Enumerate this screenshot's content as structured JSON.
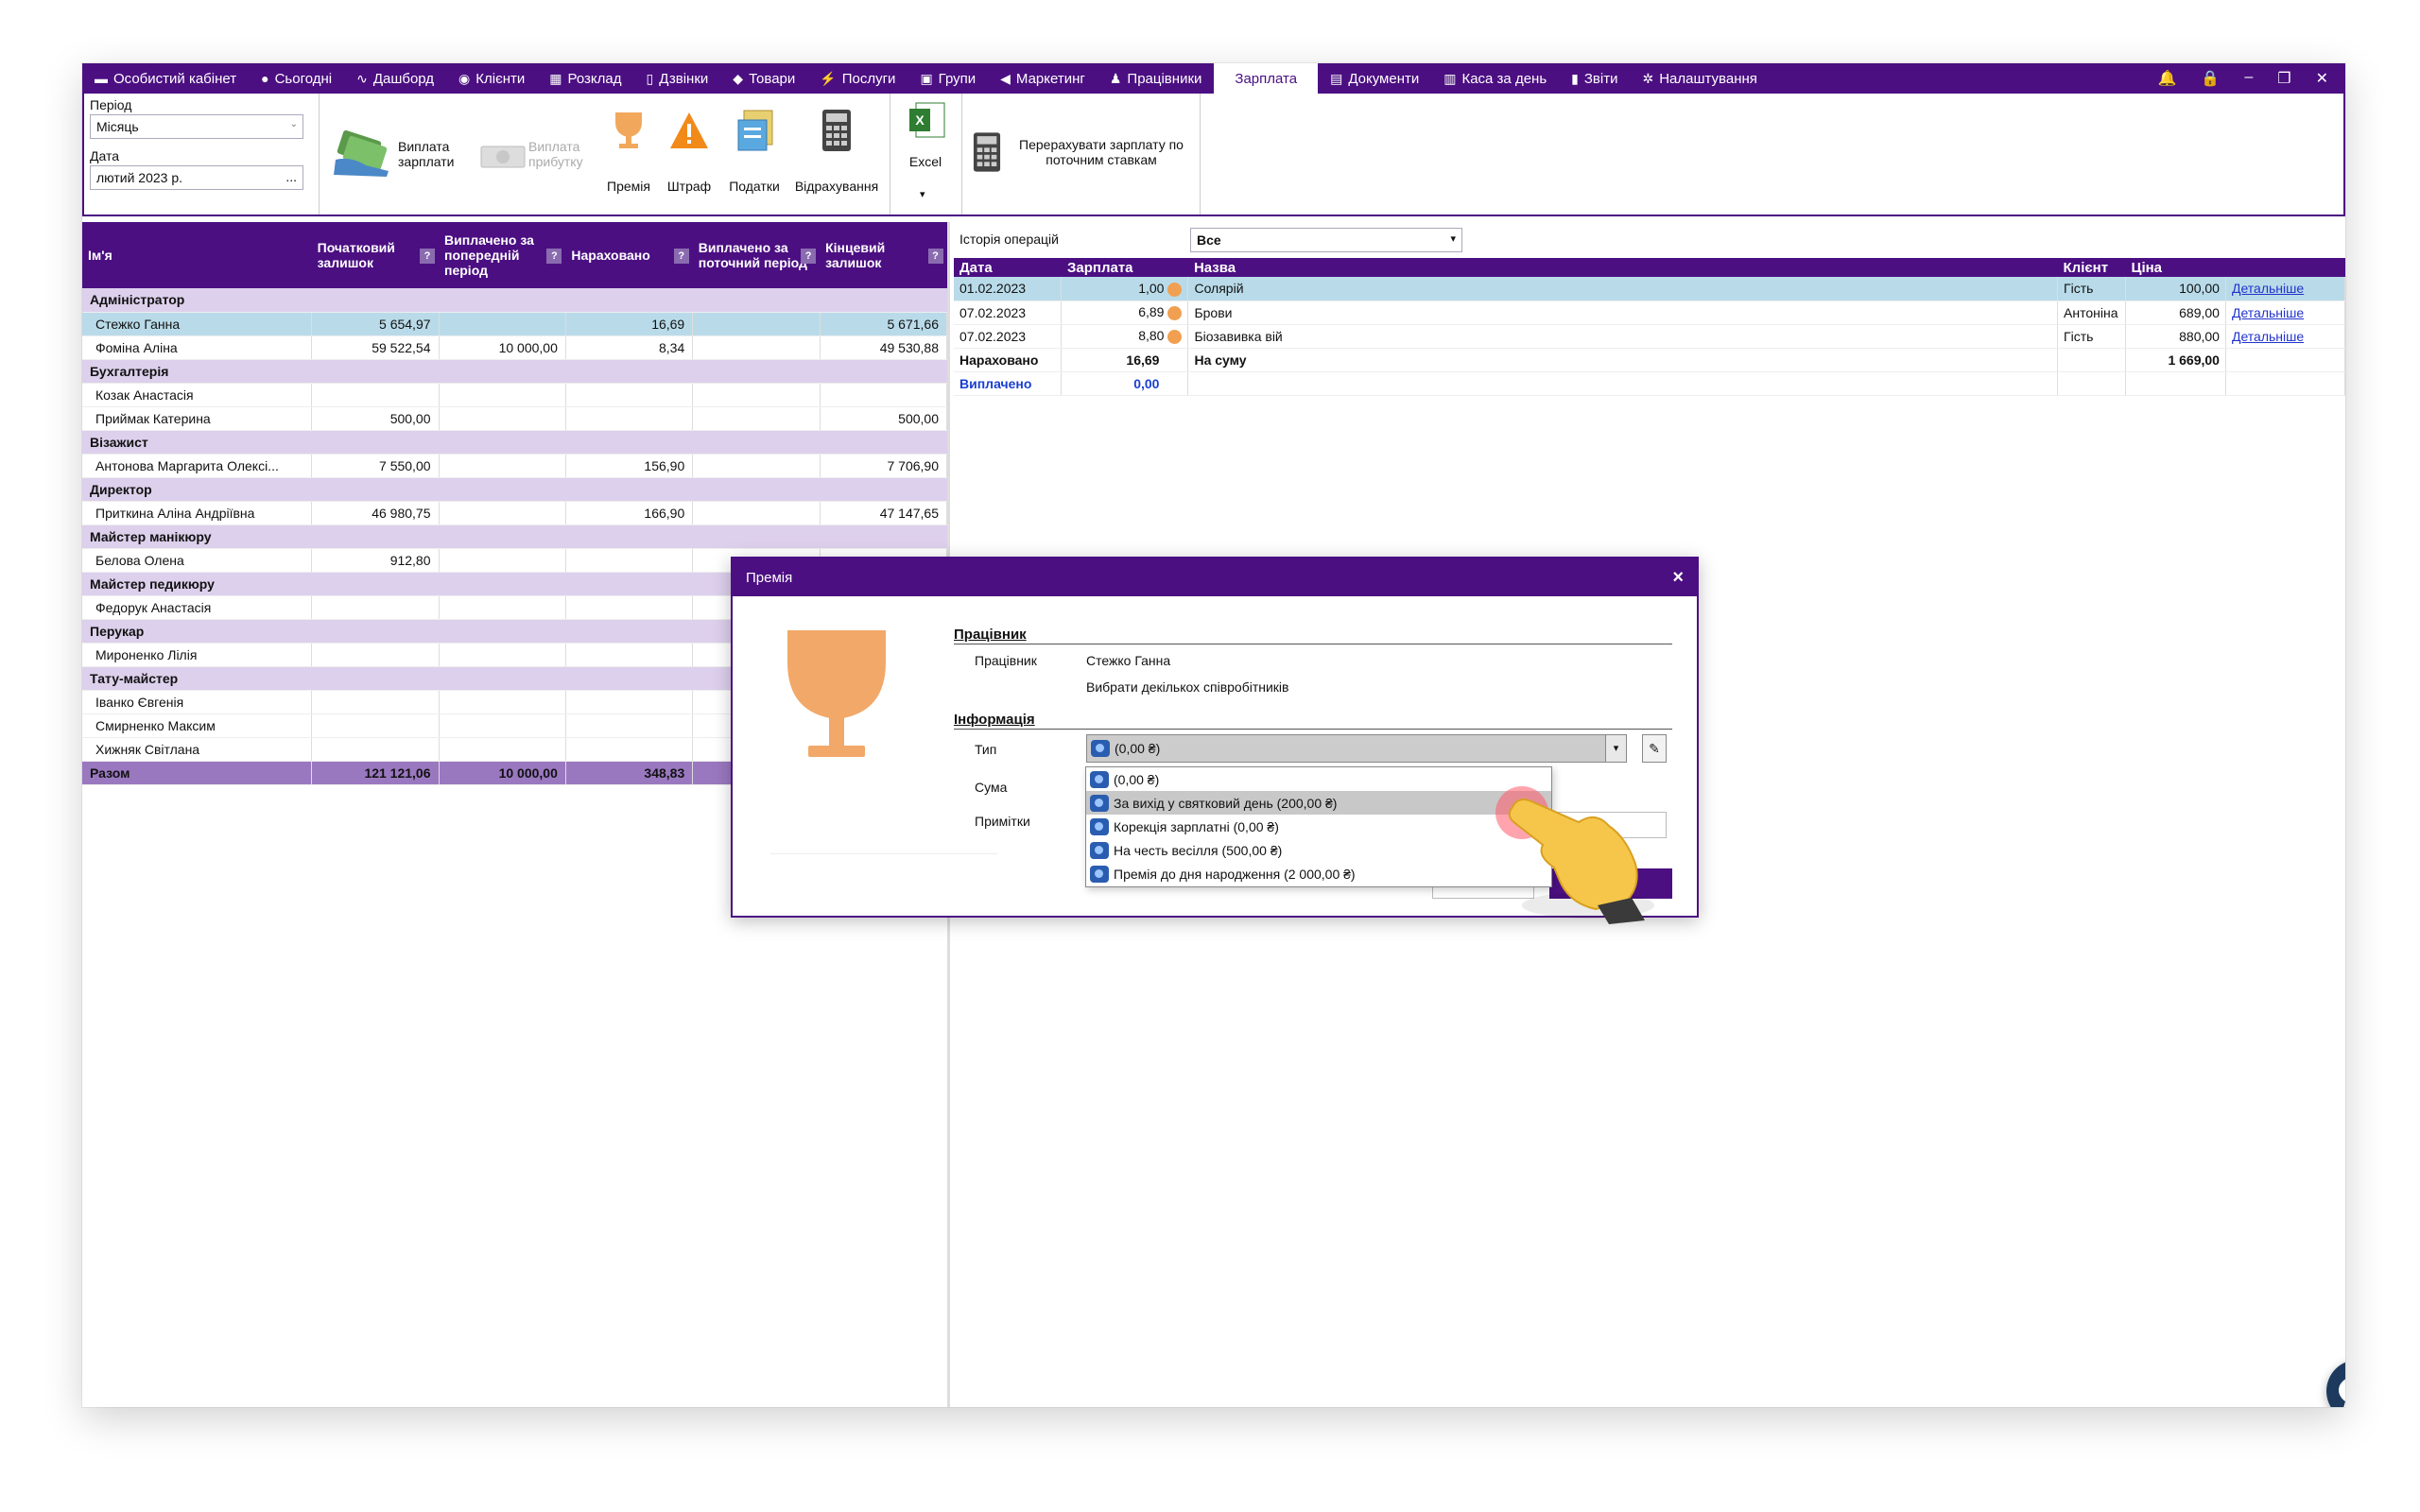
{
  "nav": {
    "items": [
      {
        "label": "Особистий кабінет",
        "icon": "briefcase-icon"
      },
      {
        "label": "Сьогодні",
        "icon": "circle-icon"
      },
      {
        "label": "Дашборд",
        "icon": "pulse-icon"
      },
      {
        "label": "Клієнти",
        "icon": "user-circle-icon"
      },
      {
        "label": "Розклад",
        "icon": "calendar-icon"
      },
      {
        "label": "Дзвінки",
        "icon": "phone-icon"
      },
      {
        "label": "Товари",
        "icon": "box-icon"
      },
      {
        "label": "Послуги",
        "icon": "bolt-icon"
      },
      {
        "label": "Групи",
        "icon": "group-icon"
      },
      {
        "label": "Маркетинг",
        "icon": "megaphone-icon"
      },
      {
        "label": "Працівники",
        "icon": "person-icon"
      },
      {
        "label": "Зарплата",
        "icon": ""
      },
      {
        "label": "Документи",
        "icon": "document-icon"
      },
      {
        "label": "Каса за день",
        "icon": "calculator-icon"
      },
      {
        "label": "Звіти",
        "icon": "bar-chart-icon"
      },
      {
        "label": "Налаштування",
        "icon": "gear-icon"
      }
    ],
    "active": "Зарплата"
  },
  "ribbon": {
    "period_label": "Період",
    "period_value": "Місяць",
    "date_label": "Дата",
    "date_value": "лютий  2023 р.",
    "date_btn": "...",
    "pay_salary": "Виплата зарплати",
    "pay_profit": "Виплата прибутку",
    "bonus": "Премія",
    "fine": "Штраф",
    "taxes": "Податки",
    "deductions": "Відрахування",
    "excel": "Excel",
    "recalc": "Перерахувати зарплату по поточним ставкам"
  },
  "left": {
    "headers": [
      "Ім'я",
      "Початковий залишок",
      "Виплачено за попередній період",
      "Нараховано",
      "Виплачено за поточний період",
      "Кінцевий залишок"
    ],
    "rows": [
      {
        "type": "grp",
        "name": "Адміністратор"
      },
      {
        "type": "sel",
        "name": "Стежко Ганна",
        "c1": "5 654,97",
        "c2": "",
        "c3": "16,69",
        "c4": "",
        "c5": "5 671,66"
      },
      {
        "type": "row",
        "name": "Фоміна Аліна",
        "c1": "59 522,54",
        "c2": "10 000,00",
        "c3": "8,34",
        "c4": "",
        "c5": "49 530,88"
      },
      {
        "type": "grp",
        "name": "Бухгалтерія"
      },
      {
        "type": "row",
        "name": "Козак Анастасія",
        "c1": "",
        "c2": "",
        "c3": "",
        "c4": "",
        "c5": ""
      },
      {
        "type": "row",
        "name": "Приймак Катерина",
        "c1": "500,00",
        "c2": "",
        "c3": "",
        "c4": "",
        "c5": "500,00"
      },
      {
        "type": "grp",
        "name": "Візажист"
      },
      {
        "type": "row",
        "name": "Антонова Маргарита Олексі...",
        "c1": "7 550,00",
        "c2": "",
        "c3": "156,90",
        "c4": "",
        "c5": "7 706,90"
      },
      {
        "type": "grp",
        "name": "Директор"
      },
      {
        "type": "row",
        "name": "Приткина Аліна Андріївна",
        "c1": "46 980,75",
        "c2": "",
        "c3": "166,90",
        "c4": "",
        "c5": "47 147,65"
      },
      {
        "type": "grp",
        "name": "Майстер манікюру"
      },
      {
        "type": "row",
        "name": "Белова Олена",
        "c1": "912,80",
        "c2": "",
        "c3": "",
        "c4": "",
        "c5": ""
      },
      {
        "type": "grp",
        "name": "Майстер педикюру"
      },
      {
        "type": "row",
        "name": "Федорук Анастасія",
        "c1": "",
        "c2": "",
        "c3": "",
        "c4": "",
        "c5": ""
      },
      {
        "type": "grp",
        "name": "Перукар"
      },
      {
        "type": "row",
        "name": "Мироненко Лілія",
        "c1": "",
        "c2": "",
        "c3": "",
        "c4": "",
        "c5": ""
      },
      {
        "type": "grp",
        "name": "Тату-майстер"
      },
      {
        "type": "row",
        "name": "Іванко Євгенія",
        "c1": "",
        "c2": "",
        "c3": "",
        "c4": "",
        "c5": ""
      },
      {
        "type": "row",
        "name": "Смирненко Максим",
        "c1": "",
        "c2": "",
        "c3": "",
        "c4": "",
        "c5": ""
      },
      {
        "type": "row",
        "name": "Хижняк Світлана",
        "c1": "",
        "c2": "",
        "c3": "",
        "c4": "",
        "c5": ""
      },
      {
        "type": "tot",
        "name": "Разом",
        "c1": "121 121,06",
        "c2": "10 000,00",
        "c3": "348,83",
        "c4": "",
        "c5": ""
      }
    ]
  },
  "right": {
    "history_label": "Історія операцій",
    "history_value": "Все",
    "headers": [
      "Дата",
      "Зарплата",
      "Назва",
      "Клієнт",
      "Ціна",
      ""
    ],
    "rows": [
      {
        "date": "01.02.2023",
        "salary": "1,00",
        "name": "Солярій",
        "client": "Гість",
        "price": "100,00",
        "link": "Детальніше",
        "sel": true
      },
      {
        "date": "07.02.2023",
        "salary": "6,89",
        "name": "Брови",
        "client": "Антоніна",
        "price": "689,00",
        "link": "Детальніше"
      },
      {
        "date": "07.02.2023",
        "salary": "8,80",
        "name": "Біозавивка вій",
        "client": "Гість",
        "price": "880,00",
        "link": "Детальніше"
      }
    ],
    "accrued_label": "Нараховано",
    "accrued_value": "16,69",
    "sum_label": "На суму",
    "sum_value": "1 669,00",
    "paid_label": "Виплачено",
    "paid_value": "0,00"
  },
  "dialog": {
    "title": "Премія",
    "close": "×",
    "sec_employee": "Працівник",
    "employee_label": "Працівник",
    "employee_value": "Стежко Ганна",
    "choose_multiple": "Вибрати декількох співробітників",
    "sec_info": "Інформація",
    "type_label": "Тип",
    "type_value": "(0,00 ₴)",
    "sum_label": "Сума",
    "notes_label": "Примітки",
    "options": [
      "(0,00 ₴)",
      "За вихід у святковий день (200,00 ₴)",
      "Корекція зарплатні (0,00 ₴)",
      "На честь весілля (500,00 ₴)",
      "Премія до дня народження (2 000,00 ₴)"
    ],
    "highlighted": 1
  },
  "colors": {
    "brand": "#4b0f82",
    "selected_row": "#b9dbe9",
    "group_row": "#ddd0ec",
    "total_row": "#9a78c0"
  }
}
